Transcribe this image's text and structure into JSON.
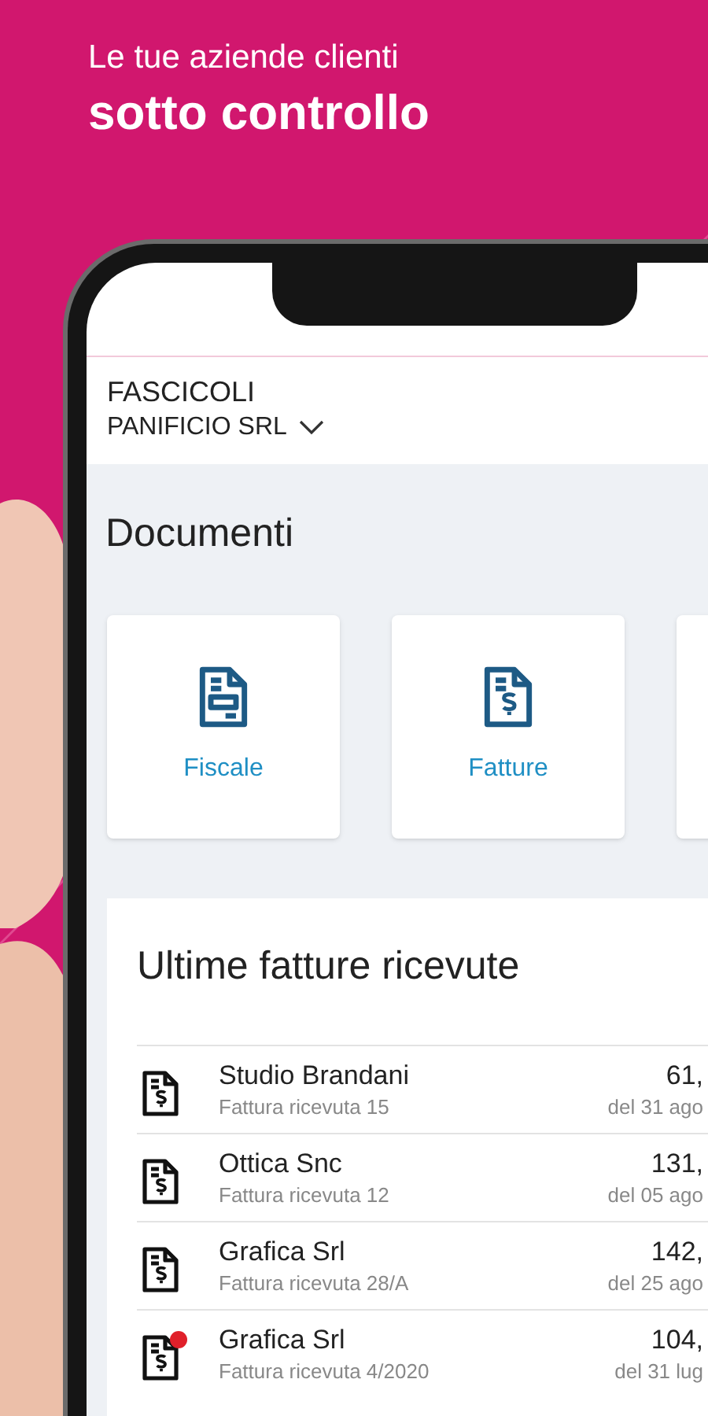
{
  "headline": {
    "line_1": "Le tue aziende clienti",
    "line_2": "sotto controllo"
  },
  "header": {
    "title": "FASCICOLI",
    "company": "PANIFICIO SRL"
  },
  "section_title": "Documenti",
  "categories": [
    {
      "kind": "form",
      "label": "Fiscale"
    },
    {
      "kind": "invoice",
      "label": "Fatture"
    },
    {
      "kind": "partial"
    }
  ],
  "invoices": {
    "title": "Ultime fatture ricevute",
    "rows": [
      {
        "name": "Studio Brandani",
        "subtitle": "Fattura ricevuta 15",
        "amount": "61,",
        "date": "del 31 ago",
        "unread": false
      },
      {
        "name": "Ottica Snc",
        "subtitle": "Fattura ricevuta 12",
        "amount": "131,",
        "date": "del 05 ago",
        "unread": false
      },
      {
        "name": "Grafica Srl",
        "subtitle": "Fattura ricevuta 28/A",
        "amount": "142,",
        "date": "del 25 ago",
        "unread": false
      },
      {
        "name": "Grafica Srl",
        "subtitle": "Fattura ricevuta 4/2020",
        "amount": "104,",
        "date": "del 31 lug",
        "unread": true
      }
    ]
  }
}
